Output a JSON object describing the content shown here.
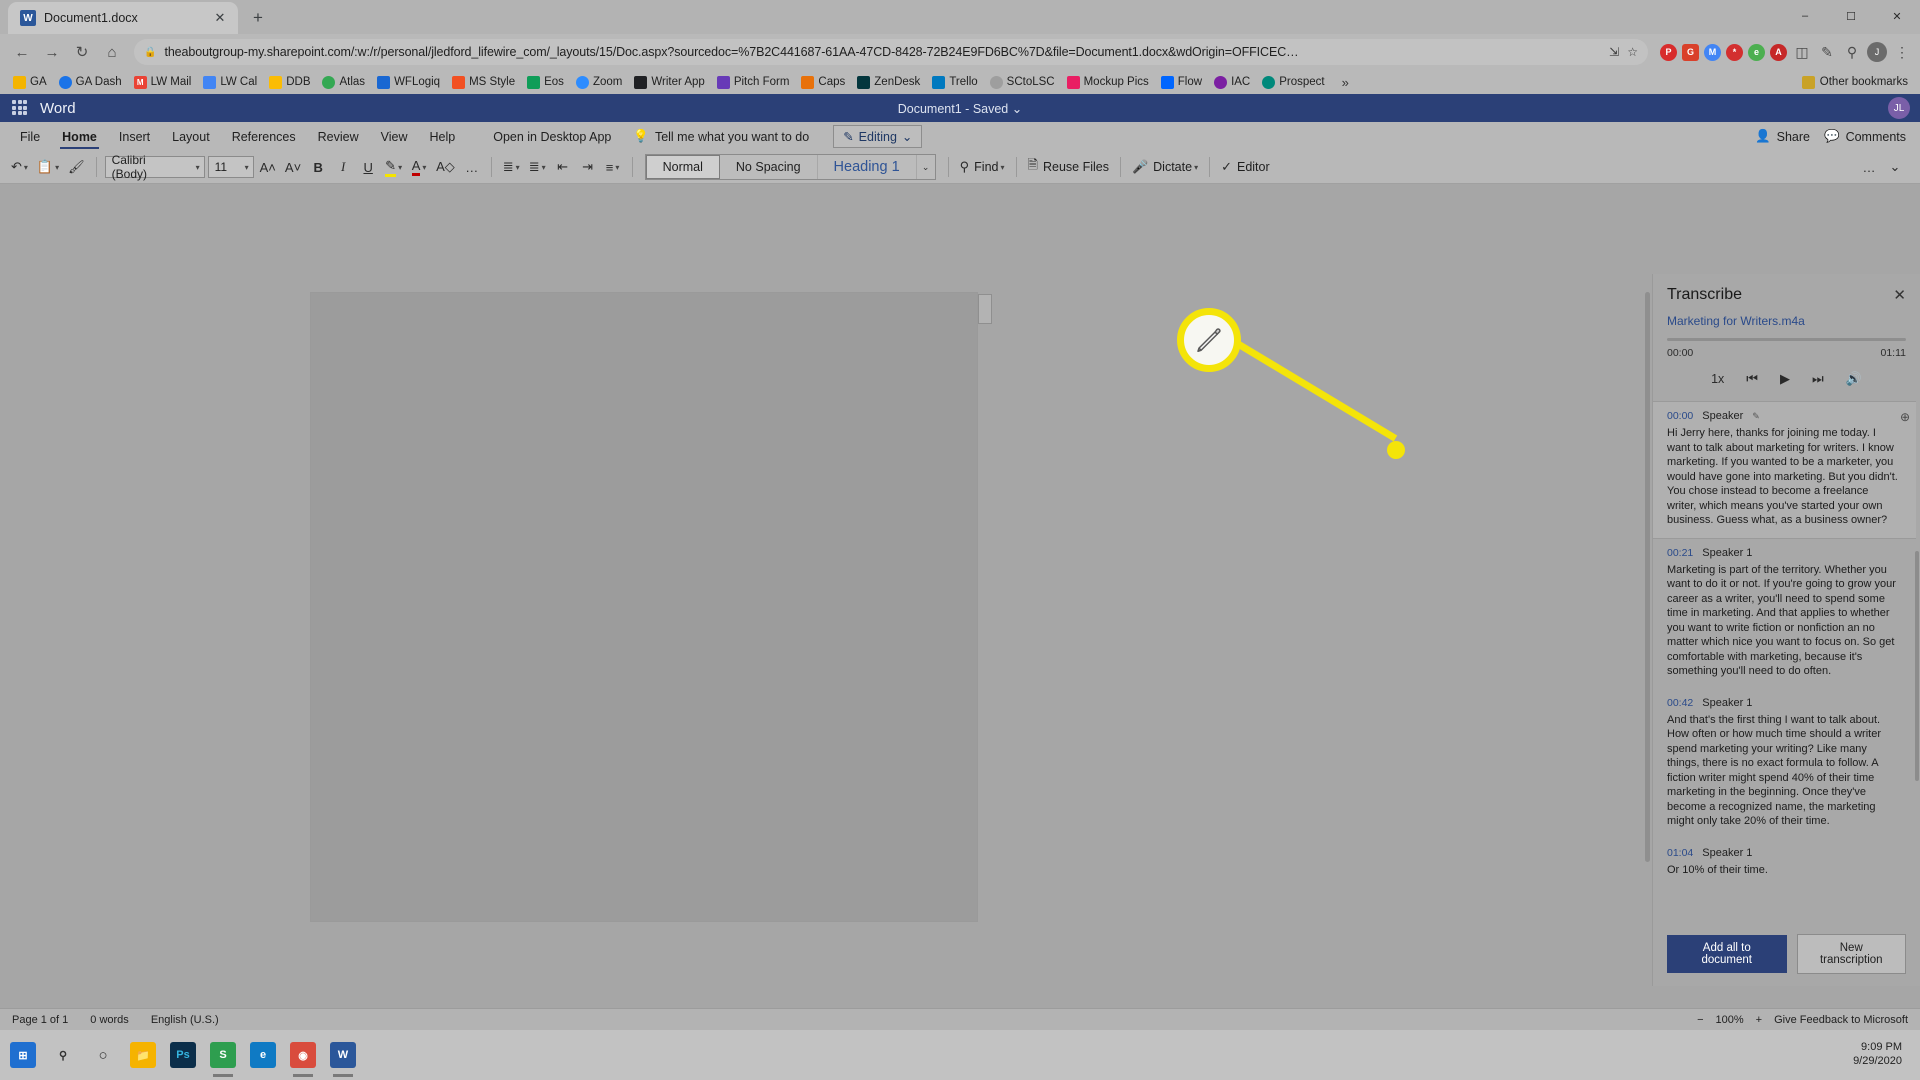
{
  "browser": {
    "tab": {
      "title": "Document1.docx",
      "favicon_letter": "W",
      "close_icon": "close-icon"
    },
    "new_tab_label": "+",
    "window_controls": {
      "minimize": "–",
      "maximize": "☐",
      "close": "✕"
    },
    "nav": {
      "back": "←",
      "forward": "→",
      "reload": "↻",
      "home": "⌂"
    },
    "omnibox": {
      "lock": "🔒",
      "url": "theaboutgroup-my.sharepoint.com/:w:/r/personal/jledford_lifewire_com/_layouts/15/Doc.aspx?sourcedoc=%7B2C441687-61AA-47CD-8428-72B24E9FD6BC%7D&file=Document1.docx&wdOrigin=OFFICEC…",
      "share_icon": "share-icon",
      "star_icon": "bookmark-star-icon"
    },
    "extensions": [
      {
        "name": "pinterest-extension",
        "label": "P",
        "color": "#d82c2c",
        "round": true
      },
      {
        "name": "grammarly-extension",
        "label": "G",
        "color": "#d9402a",
        "round": false
      },
      {
        "name": "mail-extension",
        "label": "M",
        "color": "#4285f4",
        "round": true
      },
      {
        "name": "lastpass-extension",
        "label": "*",
        "color": "#d32f2f",
        "round": true
      },
      {
        "name": "evernote-extension",
        "label": "e",
        "color": "#4caf50",
        "round": true
      },
      {
        "name": "adblock-extension",
        "label": "A",
        "color": "#c62828",
        "round": true
      },
      {
        "name": "puzzle-extensions-icon",
        "label": "🧩",
        "color": "",
        "round": false
      },
      {
        "name": "pencil-extension",
        "label": "✎",
        "color": "",
        "round": false
      },
      {
        "name": "magnifier-extension",
        "label": "⚲",
        "color": "",
        "round": false
      },
      {
        "name": "bookmark-star-icon",
        "label": "☆",
        "color": "",
        "round": false
      }
    ],
    "profile_initial": "J",
    "chrome_menu_icon": "kebab-menu-icon",
    "bookmarks": [
      {
        "label": "GA",
        "color": "#f4b400"
      },
      {
        "label": "GA Dash",
        "color": "#1a73e8"
      },
      {
        "label": "LW Mail",
        "color": "#ea4335"
      },
      {
        "label": "LW Cal",
        "color": "#4285f4"
      },
      {
        "label": "DDB",
        "color": "#fbbc04"
      },
      {
        "label": "Atlas",
        "color": "#34a853"
      },
      {
        "label": "WFLogiq",
        "color": "#1967d2"
      },
      {
        "label": "MS Style",
        "color": "#f25022"
      },
      {
        "label": "Eos",
        "color": "#0f9d58"
      },
      {
        "label": "Zoom",
        "color": "#2d8cff"
      },
      {
        "label": "Writer App",
        "color": "#202124"
      },
      {
        "label": "Pitch Form",
        "color": "#673ab7"
      },
      {
        "label": "Caps",
        "color": "#e8710a"
      },
      {
        "label": "ZenDesk",
        "color": "#03363d"
      },
      {
        "label": "Trello",
        "color": "#0079bf"
      },
      {
        "label": "SCtoLSC",
        "color": "#9e9e9e"
      },
      {
        "label": "Mockup Pics",
        "color": "#e91e63"
      },
      {
        "label": "Flow",
        "color": "#0066ff"
      },
      {
        "label": "IAC",
        "color": "#7b1fa2"
      },
      {
        "label": "Prospect",
        "color": "#00897b"
      }
    ],
    "bookmarks_overflow": "»",
    "other_bookmarks": {
      "label": "Other bookmarks",
      "folder_icon": "folder-icon"
    }
  },
  "word": {
    "waffle_icon": "app-launcher-icon",
    "brand": "Word",
    "doc_title": "Document1",
    "save_state": "Saved",
    "save_caret": "⌄",
    "avatar_initials": "JL",
    "ribbon_tabs": [
      {
        "label": "File",
        "active": false
      },
      {
        "label": "Home",
        "active": true
      },
      {
        "label": "Insert",
        "active": false
      },
      {
        "label": "Layout",
        "active": false
      },
      {
        "label": "References",
        "active": false
      },
      {
        "label": "Review",
        "active": false
      },
      {
        "label": "View",
        "active": false
      },
      {
        "label": "Help",
        "active": false
      }
    ],
    "open_in_desktop": "Open in Desktop App",
    "tell_me": {
      "icon": "lightbulb-icon",
      "label": "Tell me what you want to do"
    },
    "editing_button": {
      "icon": "pencil-icon",
      "label": "Editing",
      "caret": "⌄"
    },
    "share_button": {
      "icon": "share-person-icon",
      "label": "Share"
    },
    "comments_button": {
      "icon": "comment-icon",
      "label": "Comments"
    },
    "toolbar": {
      "undo": "↶",
      "paste": "📋",
      "format_painter": "🖌",
      "font_name": "Calibri (Body)",
      "font_size": "11",
      "grow_font": "A˄",
      "shrink_font": "A˅",
      "bold": "B",
      "italic": "I",
      "underline": "U",
      "highlight": "✎",
      "font_color": "A",
      "clear_format": "A◇",
      "more_font": "…",
      "bullets": "≣",
      "numbering": "≣",
      "decrease_indent": "←≡",
      "increase_indent": "→≡",
      "align": "≡",
      "styles": [
        {
          "label": "Normal",
          "selected": true
        },
        {
          "label": "No Spacing",
          "selected": false
        },
        {
          "label": "Heading 1",
          "selected": false
        }
      ],
      "styles_more_caret": "⌄",
      "find": {
        "icon": "search-icon",
        "label": "Find",
        "caret": "⌄"
      },
      "reuse_files": {
        "icon": "reuse-files-icon",
        "label": "Reuse Files"
      },
      "dictate": {
        "icon": "microphone-icon",
        "label": "Dictate",
        "caret": "⌄"
      },
      "editor": {
        "icon": "editor-pen-icon",
        "label": "Editor"
      },
      "overflow": "…",
      "collapse_ribbon": "⌄"
    }
  },
  "transcribe": {
    "panel_title": "Transcribe",
    "close_icon": "close-icon",
    "audio_file": "Marketing for Writers.m4a",
    "time_start": "00:00",
    "time_end": "01:11",
    "controls": {
      "speed": "1x",
      "rewind": "⏮",
      "play": "▶",
      "forward": "⏭",
      "volume": "🔊"
    },
    "segments": [
      {
        "time": "00:00",
        "speaker": "Speaker",
        "active": true,
        "text": "Hi Jerry here, thanks for joining me today. I want to talk about marketing for writers. I know marketing. If you wanted to be a marketer, you would have gone into marketing. But you didn't. You chose instead to become a freelance writer, which means you've started your own business. Guess what, as a business owner?"
      },
      {
        "time": "00:21",
        "speaker": "Speaker 1",
        "active": false,
        "text": "Marketing is part of the territory. Whether you want to do it or not. If you're going to grow your career as a writer, you'll need to spend some time in marketing. And that applies to whether you want to write fiction or nonfiction an no matter which nice you want to focus on. So get comfortable with marketing, because it's something you'll need to do often."
      },
      {
        "time": "00:42",
        "speaker": "Speaker 1",
        "active": false,
        "text": "And that's the first thing I want to talk about. How often or how much time should a writer spend marketing your writing? Like many things, there is no exact formula to follow. A fiction writer might spend 40% of their time marketing in the beginning. Once they've become a recognized name, the marketing might only take 20% of their time."
      },
      {
        "time": "01:04",
        "speaker": "Speaker 1",
        "active": false,
        "text": "Or 10% of their time."
      }
    ],
    "add_all_button": "Add all to document",
    "new_transcription_button": "New transcription",
    "add_segment_icon": "add-circle-icon",
    "edit_segment_icon": "pencil-edit-icon"
  },
  "status_bar": {
    "page": "Page 1 of 1",
    "words": "0 words",
    "language": "English (U.S.)",
    "zoom_out": "−",
    "zoom_level": "100%",
    "zoom_in": "+",
    "feedback": "Give Feedback to Microsoft"
  },
  "taskbar": {
    "items": [
      {
        "name": "start-button",
        "label": "⊞",
        "color": "#1f6fd0"
      },
      {
        "name": "search-icon",
        "label": "⚲",
        "color": "transparent"
      },
      {
        "name": "cortana-icon",
        "label": "○",
        "color": "transparent"
      },
      {
        "name": "file-explorer-icon",
        "label": "🗀",
        "color": "#f5b300"
      },
      {
        "name": "photoshop-icon",
        "label": "Ps",
        "color": "#0b2e4a"
      },
      {
        "name": "snagit-icon",
        "label": "S",
        "color": "#2e9e4f"
      },
      {
        "name": "edge-icon",
        "label": "e",
        "color": "#0f7ac4"
      },
      {
        "name": "chrome-icon",
        "label": "◉",
        "color": "#d94c3d"
      },
      {
        "name": "word-icon",
        "label": "W",
        "color": "#2b579a"
      }
    ],
    "time": "9:09 PM",
    "date": "9/29/2020"
  },
  "annotation": {
    "icon": "pencil-callout-icon",
    "accent_color": "#f4e409"
  }
}
